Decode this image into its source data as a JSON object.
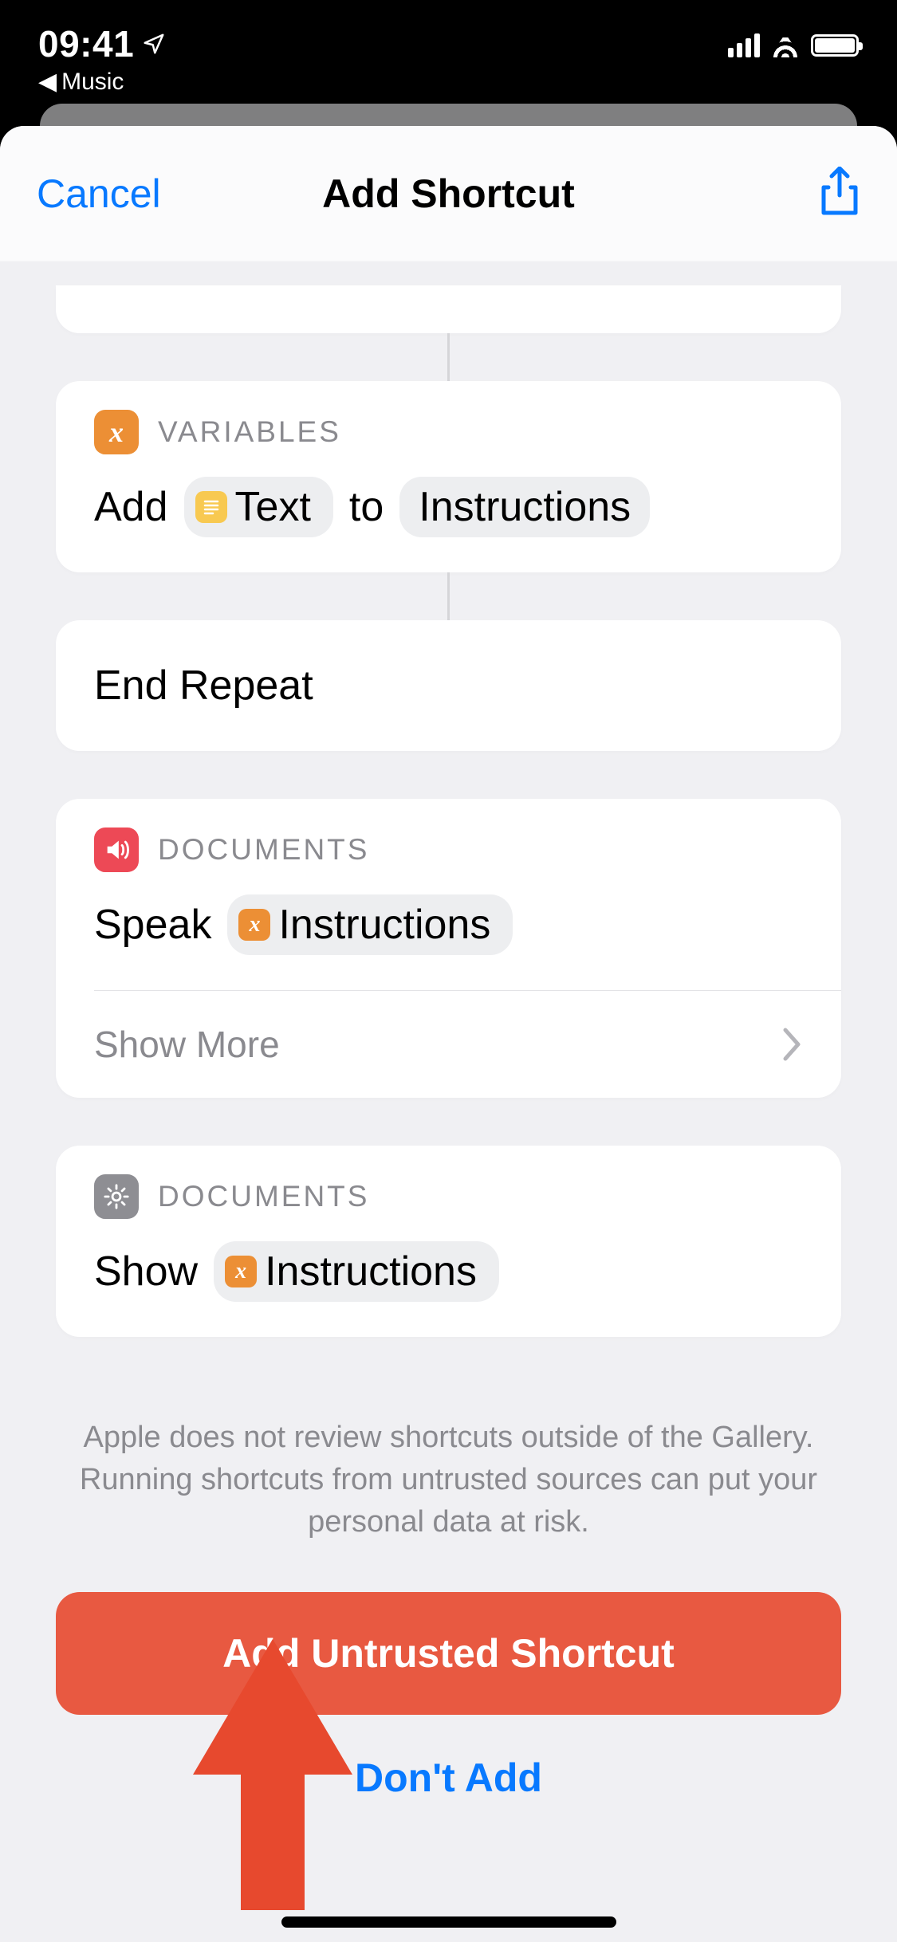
{
  "status": {
    "time": "09:41",
    "back_app": "Music"
  },
  "navbar": {
    "cancel": "Cancel",
    "title": "Add Shortcut"
  },
  "actions": {
    "variables": {
      "section": "VARIABLES",
      "verb": "Add",
      "token1": "Text",
      "joiner": "to",
      "token2": "Instructions"
    },
    "end_repeat": "End Repeat",
    "speak": {
      "section": "DOCUMENTS",
      "verb": "Speak",
      "token": "Instructions",
      "show_more": "Show More"
    },
    "show": {
      "section": "DOCUMENTS",
      "verb": "Show",
      "token": "Instructions"
    }
  },
  "warning": "Apple does not review shortcuts outside of the Gallery. Running shortcuts from untrusted sources can put your personal data at risk.",
  "buttons": {
    "add": "Add Untrusted Shortcut",
    "dont_add": "Don't Add"
  }
}
